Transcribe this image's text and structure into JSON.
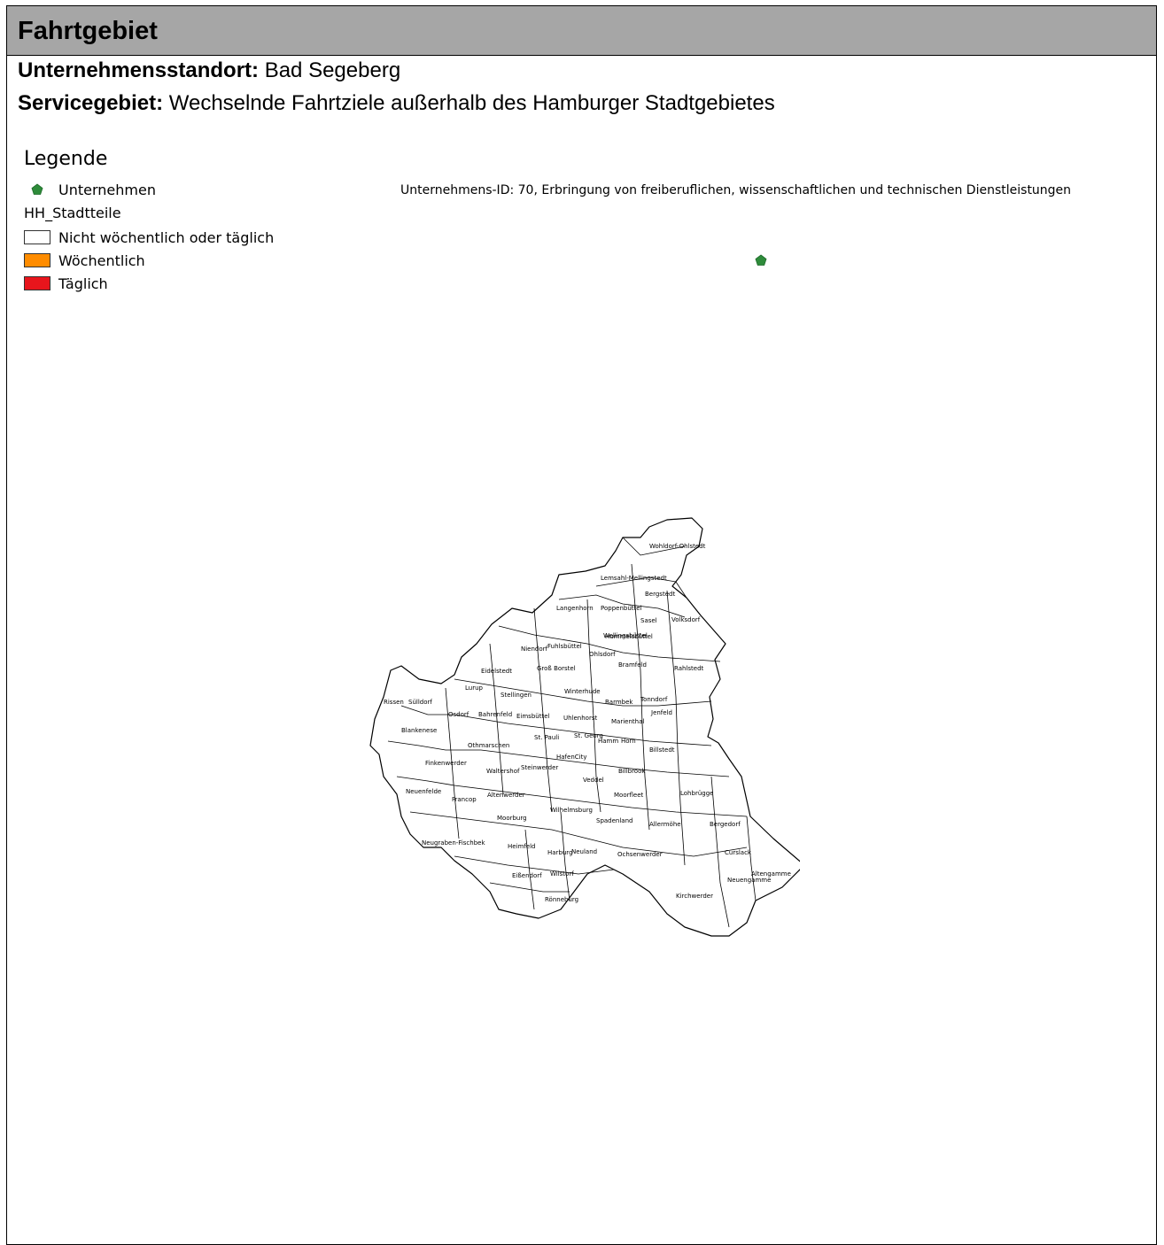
{
  "header": {
    "title": "Fahrtgebiet"
  },
  "info": {
    "location_label": "Unternehmensstandort:",
    "location_value": "Bad Segeberg",
    "service_label": "Servicegebiet:",
    "service_value": "Wechselnde Fahrtziele außerhalb des Hamburger Stadtgebietes"
  },
  "legend": {
    "title": "Legende",
    "company_label": "Unternehmen",
    "company_color": "#2e8b3a",
    "layer_name": "HH_Stadtteile",
    "classes": [
      {
        "label": "Nicht wöchentlich oder täglich",
        "color": "#ffffff"
      },
      {
        "label": "Wöchentlich",
        "color": "#ff8c00"
      },
      {
        "label": "Täglich",
        "color": "#e8151c"
      }
    ]
  },
  "map": {
    "company_caption": "Unternehmens-ID: 70,  Erbringung von freiberuflichen, wissenschaftlichen und technischen Dienstleistungen",
    "district_fill": "#ffffff",
    "district_stroke": "#000000",
    "districts": [
      "Wohldorf-Ohlstedt",
      "Lemsahl-Mellingstedt",
      "Bergstedt",
      "Langenhorn",
      "Poppenbüttel",
      "Volksdorf",
      "Sasel",
      "Hummelsbüttel",
      "Niendorf",
      "Fuhlsbüttel",
      "Ohlsdorf",
      "Wellingsbüttel",
      "Bramfeld",
      "Rahlstedt",
      "Eidelstedt",
      "Groß Borstel",
      "Lurup",
      "Stellingen",
      "Winterhude",
      "Barmbek",
      "Tonndorf",
      "Rissen",
      "Sülldorf",
      "Osdorf",
      "Bahrenfeld",
      "Eimsbüttel",
      "Uhlenhorst",
      "Marienthal",
      "Jenfeld",
      "Blankenese",
      "St. Pauli",
      "St. Georg",
      "Hamm",
      "Horn",
      "Othmarschen",
      "Billstedt",
      "HafenCity",
      "Finkenwerder",
      "Waltershof",
      "Steinwerder",
      "Veddel",
      "Billbrook",
      "Neuenfelde",
      "Francop",
      "Altenwerder",
      "Moorfleet",
      "Lohbrügge",
      "Wilhelmsburg",
      "Moorburg",
      "Spadenland",
      "Allermöhe",
      "Bergedorf",
      "Neugraben-Fischbek",
      "Heimfeld",
      "Harburg",
      "Neuland",
      "Ochsenwerder",
      "Curslack",
      "Altengamme",
      "Eißendorf",
      "Wilstorf",
      "Neuengamme",
      "Kirchwerder",
      "Rönneburg"
    ]
  }
}
